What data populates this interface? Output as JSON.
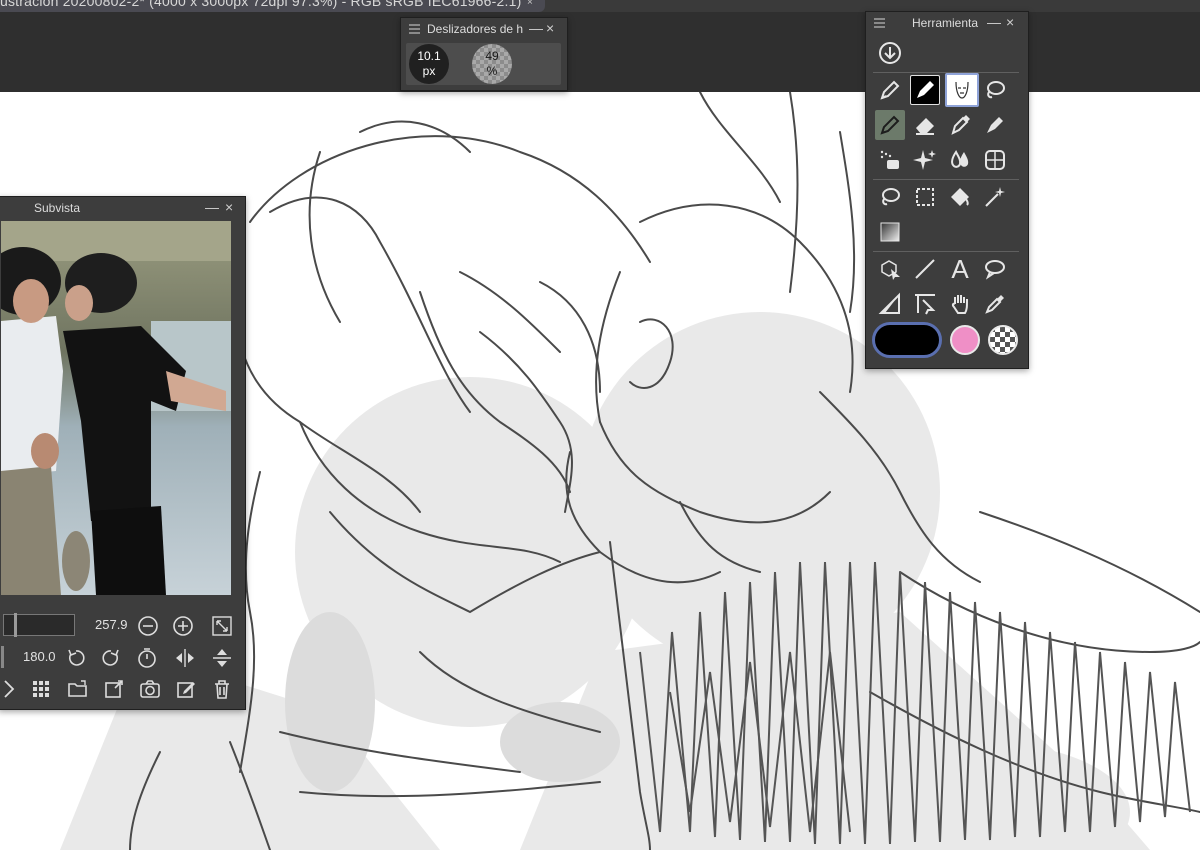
{
  "window": {
    "title": "ustración 20200802-2* (4000 x 3000px 72dpi 97.3%) - RGB sRGB IEC61966-2.1)",
    "close_glyph": "×"
  },
  "sliders_panel": {
    "title": "Deslizadores de h",
    "brush_size": {
      "value": "10.1",
      "unit": "px"
    },
    "opacity": {
      "value": "49",
      "unit": "%"
    }
  },
  "tool_panel": {
    "title": "Herramienta",
    "tools": [
      "download-icon",
      "pen-icon",
      "marker-icon",
      "face-brush-icon",
      "lasso-brush-icon",
      "pencil-icon",
      "eraser-icon",
      "ink-pen-icon",
      "calligraphy-icon",
      "spray-icon",
      "sparkle-icon",
      "blend-icon",
      "grid-icon",
      "lasso-icon",
      "rect-select-icon",
      "fill-icon",
      "magic-wand-icon",
      "gradient-icon",
      "object-select-icon",
      "line-icon",
      "text-icon",
      "balloon-icon",
      "ruler-icon",
      "correct-line-icon",
      "hand-icon",
      "eyedropper-icon"
    ],
    "text_tool_glyph": "A",
    "colors": {
      "main": "#000000",
      "sub": "#ef8fc6",
      "accent": "#5a6fb0"
    }
  },
  "subview_panel": {
    "title": "Subvista",
    "zoom_value": "257.9",
    "rotation_value": "180.0"
  },
  "controls": {
    "minimize": "—",
    "close": "×"
  }
}
